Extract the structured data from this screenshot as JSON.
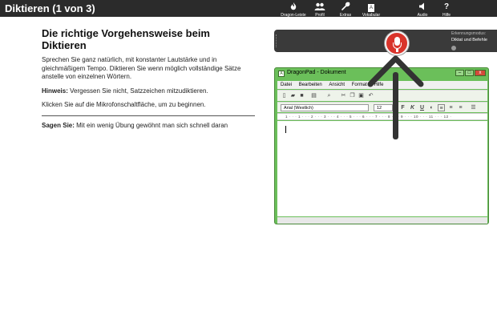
{
  "header": {
    "title": "Diktieren (1 von 3)"
  },
  "main": {
    "heading": "Die richtige Vorgehensweise beim Diktieren",
    "intro": "Sprechen Sie ganz natürlich, mit konstanter Lautstärke und in gleichmäßigem Tempo. Diktieren Sie wenn möglich vollständige Sätze anstelle von einzelnen Wörtern.",
    "hint_label": "Hinweis:",
    "hint_text": " Vergessen Sie nicht, Satzzeichen mitzudiktieren.",
    "mic_instruction": "Klicken Sie auf die Mikrofonschaltfläche, um zu beginnen.",
    "say_label": "Sagen Sie:",
    "say_text": " Mit ein wenig Übung gewöhnt man sich schnell daran"
  },
  "dragon_bar": {
    "buttons": [
      {
        "label": "Dragon-Leiste",
        "icon": "dragon-flame-icon"
      },
      {
        "label": "Profil",
        "icon": "users-icon"
      },
      {
        "label": "Extras",
        "icon": "wrench-icon"
      },
      {
        "label": "Vokabular",
        "icon": "book-icon"
      },
      {
        "label": "Audio",
        "icon": "speaker-icon"
      },
      {
        "label": "Hilfe",
        "icon": "help-icon"
      }
    ],
    "mic_icon": "microphone-icon",
    "mode_label": "Erkennungsmodus:",
    "mode_value": "Diktat und Befehle"
  },
  "dragonpad": {
    "title": "DragonPad - Dokument",
    "menu": [
      "Datei",
      "Bearbeiten",
      "Ansicht",
      "Format",
      "Hilfe"
    ],
    "font": "Arial (Westlich)",
    "size": "12",
    "format_buttons": [
      "F",
      "K",
      "U"
    ],
    "ruler": "1 · · · 1 · · · 2 · · · 3 · · · 4 · · · 5 · · · 6 · · · 7 · · · 8 · · · 9 · · · 10 · · · 11 · · · 12 ·"
  },
  "colors": {
    "header_bg": "#2b2b2b",
    "dragon_bar_bg": "#3a3a3a",
    "mic_red": "#d9342b",
    "window_green": "#6bbf5a"
  }
}
